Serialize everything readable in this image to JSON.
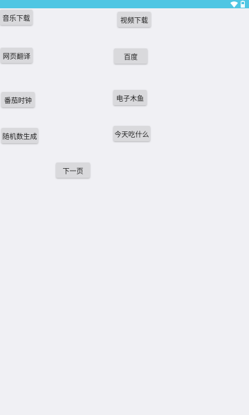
{
  "status_bar": {
    "color": "#4fc6e3",
    "icons": [
      "wifi-icon",
      "battery-icon"
    ]
  },
  "buttons": {
    "music_download": "音乐下载",
    "video_download": "视频下载",
    "web_translate": "网页翻译",
    "baidu": "百度",
    "tomato_clock": "番茄时钟",
    "electronic_muyu": "电子木鱼",
    "random_number": "随机数生成",
    "what_to_eat": "今天吃什么",
    "next_page": "下一页"
  }
}
